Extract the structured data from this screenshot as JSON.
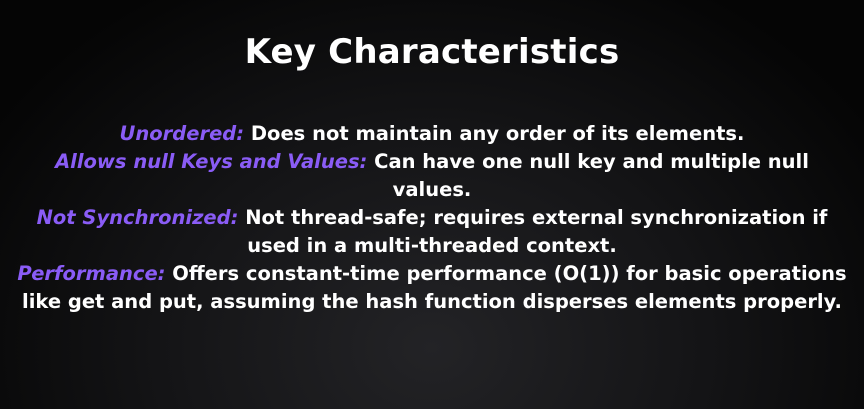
{
  "title": "Key Characteristics",
  "accent_color": "#8a5cf6",
  "points": [
    {
      "term": "Unordered:",
      "description": "Does not maintain any order of its elements."
    },
    {
      "term": "Allows null Keys and Values:",
      "description": "Can have one null key and multiple null values."
    },
    {
      "term": "Not Synchronized:",
      "description": "Not thread-safe; requires external synchronization if used in a multi-threaded context."
    },
    {
      "term": "Performance:",
      "description": "Offers constant-time performance (O(1)) for basic operations like get and put, assuming the hash function disperses elements properly."
    }
  ]
}
